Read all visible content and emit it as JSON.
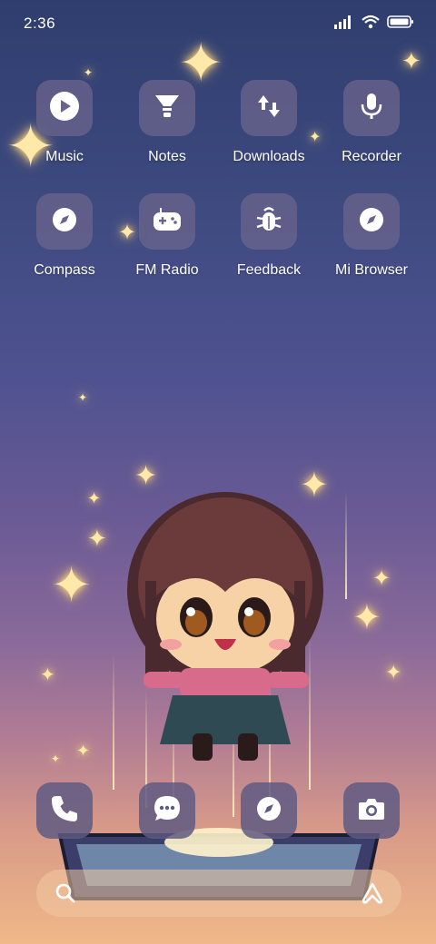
{
  "status_bar": {
    "time": "2:36",
    "icons": [
      "signal-icon",
      "wifi-icon",
      "battery-icon"
    ]
  },
  "apps_row1": [
    {
      "label": "Music",
      "icon": "play-icon"
    },
    {
      "label": "Notes",
      "icon": "notes-icon"
    },
    {
      "label": "Downloads",
      "icon": "download-arrows-icon"
    },
    {
      "label": "Recorder",
      "icon": "microphone-icon"
    }
  ],
  "apps_row2": [
    {
      "label": "Compass",
      "icon": "compass-icon"
    },
    {
      "label": "FM Radio",
      "icon": "gamepad-icon"
    },
    {
      "label": "Feedback",
      "icon": "bug-icon"
    },
    {
      "label": "Mi Browser",
      "icon": "compass-icon"
    }
  ],
  "dock": [
    {
      "icon": "phone-icon"
    },
    {
      "icon": "messages-icon"
    },
    {
      "icon": "compass-icon"
    },
    {
      "icon": "camera-icon"
    }
  ],
  "search_bar": {
    "left_icon": "search-icon",
    "right_icon": "assistant-icon"
  },
  "colors": {
    "tile": "#69648c",
    "sky_top": "#2f3d6e",
    "sky_bottom": "#f0b889"
  }
}
